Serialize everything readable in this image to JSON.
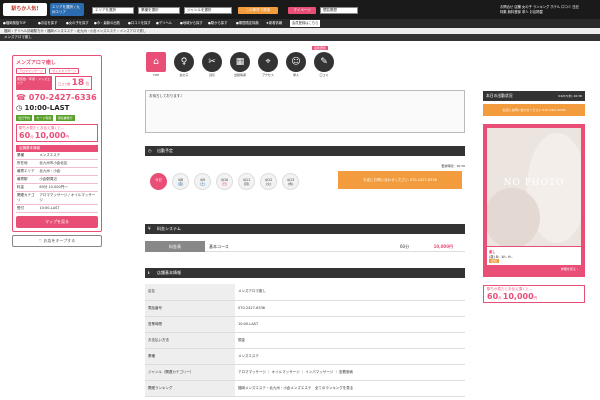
{
  "header": {
    "logo": "駅ちか人気!",
    "area_label": "エリアを選択 / 九州エリア",
    "area_select": "エリアを選択",
    "type_select": "業種を選択",
    "genre_select": "ジャンルを選択",
    "search_btn": "この条件で検索",
    "mypage_btn": "マイページ",
    "history_select": "閲覧履歴",
    "top_links": [
      "お問合せ",
      "店舗",
      "女の子",
      "ランキング",
      "ホテル",
      "口コミ",
      "日記"
    ],
    "top_links2": [
      "特集",
      "無料登録",
      "求人",
      "お店掲載"
    ]
  },
  "nav": {
    "items": [
      "●福岡風俗TOP",
      "●お店を探す",
      "●女の子を探す",
      "●今・最新の出勤",
      "●口コミを探す",
      "●デリヘル",
      "●地域から探す",
      "●駅から探す",
      "●期間限定特典",
      "★新着情報"
    ],
    "extra": "会員登録はこちら"
  },
  "breadcrumb": "福岡 › デリヘル情報駅ちか › 福岡メンズエステ › 北九州・小倉メンズエステ › メンズアロマ癒し",
  "page_title": "メンズアロマ癒し",
  "shop": {
    "name": "メンズアロマ癒し",
    "tags": [
      "アロママッサージ",
      "オイルマッサージ"
    ],
    "badge": "閲覧数／年間・メンズエステ",
    "price_rank_label": "口コミ数",
    "rank_num": "18",
    "rank_unit": "位",
    "phone": "070-2427-6336",
    "hours": "10:00-LAST",
    "green_tags": [
      "当日予約",
      "カード利用",
      "領収書発行"
    ],
    "msg_line": "駅ちか見たとお伝え頂くと…",
    "msg_price": "60",
    "msg_price_unit": "分",
    "msg_price2": "10,000",
    "msg_price2_unit": "円",
    "info_title": "店舗基本情報",
    "info": [
      {
        "k": "業種",
        "v": "メンズエステ"
      },
      {
        "k": "所在地",
        "v": "北九州市小倉北区"
      },
      {
        "k": "最寄エリア",
        "v": "北九州・小倉"
      },
      {
        "k": "最寄駅",
        "v": "小倉駅周辺"
      },
      {
        "k": "料金",
        "v": "60分 10,000円〜"
      },
      {
        "k": "関連カテゴリ",
        "v": "アロママッサージ / オイルマッサージ"
      },
      {
        "k": "受付",
        "v": "10:00-LAST"
      }
    ],
    "map_btn": "マップを見る",
    "keep_btn": "お店をキープする"
  },
  "icons": [
    {
      "name": "home-icon",
      "glyph": "⌂",
      "label": "TOP"
    },
    {
      "name": "female-icon",
      "glyph": "♀",
      "label": "女の子"
    },
    {
      "name": "coupon-icon",
      "glyph": "✂",
      "label": "割引"
    },
    {
      "name": "schedule-icon",
      "glyph": "▦",
      "label": "出勤情報"
    },
    {
      "name": "access-icon",
      "glyph": "⌖",
      "label": "アクセス"
    },
    {
      "name": "recruit-icon",
      "glyph": "☺",
      "label": "求人"
    },
    {
      "name": "diary-icon",
      "glyph": "✎",
      "label": "口コミ"
    }
  ],
  "new_badge": "最新更新",
  "message_text": "お待ちしております♪",
  "schedule": {
    "title": "出勤予定",
    "updated": "更新時間：16:36",
    "days": [
      {
        "date": "今日",
        "dow": ""
      },
      {
        "date": "4/8",
        "dow": "(金)"
      },
      {
        "date": "4/9",
        "dow": "(土)"
      },
      {
        "date": "4/10",
        "dow": "(日)"
      },
      {
        "date": "4/11",
        "dow": "(月)"
      },
      {
        "date": "4/12",
        "dow": "(火)"
      },
      {
        "date": "4/13",
        "dow": "(水)"
      }
    ],
    "call_btn": "お店にお問い合わせください 070-2427-6336"
  },
  "pricing": {
    "title": "料金システム",
    "label": "料金表",
    "course": "基本コース",
    "minutes": "60分",
    "price": "10,000円"
  },
  "details": {
    "title": "店舗基本情報",
    "rows": [
      {
        "k": "店名",
        "v": "メンズアロマ癒し"
      },
      {
        "k": "電話番号",
        "v": "070-2427-6336"
      },
      {
        "k": "営業時間",
        "v": "10:00-LAST"
      },
      {
        "k": "お支払い方法",
        "v": "現金"
      },
      {
        "k": "業種",
        "v": "メンズエステ"
      },
      {
        "k": "ジャンル（関連カテゴリー）",
        "v": "アロママッサージ ｜ オイルマッサージ ｜ リンパマッサージ ｜ 密着施術"
      },
      {
        "k": "関連ランキング",
        "v": "福岡メンズエステ・北九州・小倉メンズエステ"
      }
    ],
    "rank_link": "全てのランキングを見る"
  },
  "right": {
    "title": "本日の出勤状況",
    "date": "04/07(木) 16:36",
    "orange": "お店にお問い合わせください 070-2427-6336",
    "nophoto": "NO PHOTO",
    "girl_name": "癒し",
    "girl_spec": "(歳) B:- W:- H:-",
    "girl_badge": "出勤",
    "detail_btn": "詳細を見る ›",
    "msg_line": "駅ちか見たとお伝え頂くと…",
    "msg_price": "60",
    "msg_price_unit": "分",
    "msg_price2": "10,000",
    "msg_price2_unit": "円"
  },
  "colors": {
    "accent": "#e94e77",
    "dark": "#333333",
    "orange": "#f39c3d",
    "green": "#5aa02c"
  }
}
